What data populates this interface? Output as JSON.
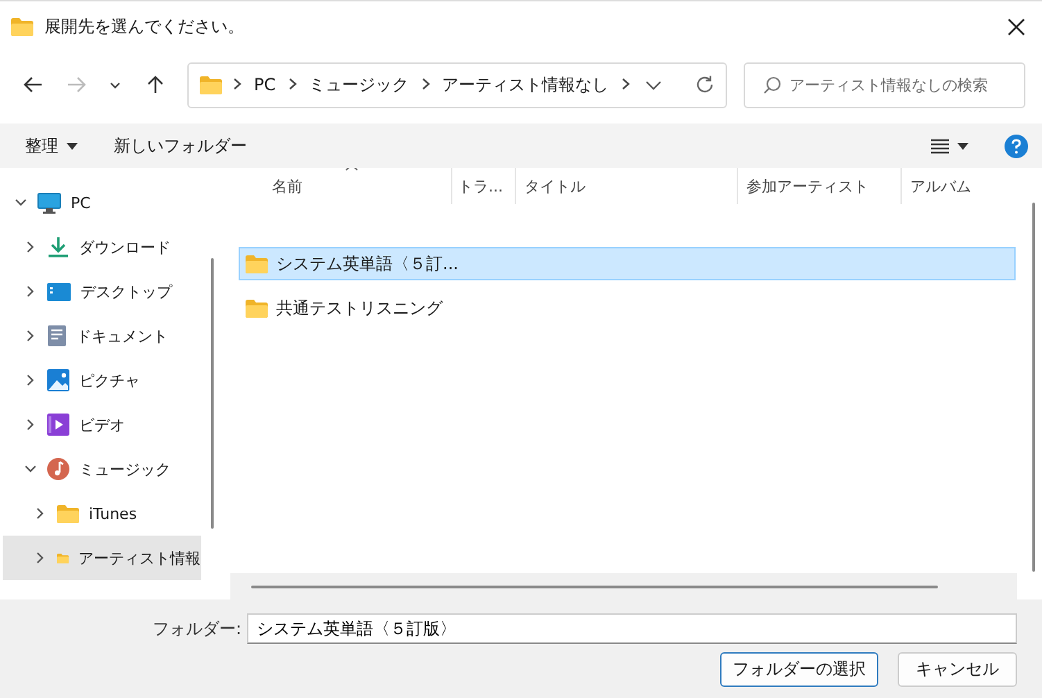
{
  "window": {
    "title": "展開先を選んでください。"
  },
  "navigation": {
    "forward_disabled": true,
    "address": [
      "PC",
      "ミュージック",
      "アーティスト情報なし"
    ],
    "search": {
      "placeholder": "アーティスト情報なしの検索"
    }
  },
  "toolbar": {
    "organize": "整理",
    "new_folder": "新しいフォルダー"
  },
  "tree": {
    "items": [
      {
        "label": "PC",
        "kind": "pc",
        "expanded": true,
        "selected": false,
        "children": [
          {
            "label": "ダウンロード",
            "kind": "download",
            "expanded": false,
            "selected": false
          },
          {
            "label": "デスクトップ",
            "kind": "desktop",
            "expanded": false,
            "selected": false
          },
          {
            "label": "ドキュメント",
            "kind": "document",
            "expanded": false,
            "selected": false
          },
          {
            "label": "ピクチャ",
            "kind": "picture",
            "expanded": false,
            "selected": false
          },
          {
            "label": "ビデオ",
            "kind": "video",
            "expanded": false,
            "selected": false
          },
          {
            "label": "ミュージック",
            "kind": "music",
            "expanded": true,
            "selected": false,
            "children": [
              {
                "label": "iTunes",
                "kind": "folder",
                "expanded": false,
                "selected": false
              },
              {
                "label": "アーティスト情報",
                "kind": "folder",
                "expanded": false,
                "selected": true
              }
            ]
          }
        ]
      }
    ]
  },
  "table": {
    "columns": [
      {
        "label": "名前",
        "sorted": true
      },
      {
        "label": "トラ...",
        "sorted": false
      },
      {
        "label": "タイトル",
        "sorted": false
      },
      {
        "label": "参加アーティスト",
        "sorted": false
      },
      {
        "label": "アルバム",
        "sorted": false
      }
    ],
    "rows": [
      {
        "name": "システム英単語〈５訂...",
        "selected": true
      },
      {
        "name": "共通テストリスニング",
        "selected": false
      }
    ]
  },
  "footer": {
    "folder_label": "フォルダー:",
    "folder_value": "システム英単語〈５訂版〉",
    "buttons": [
      {
        "label": "フォルダーの選択",
        "primary": true
      },
      {
        "label": "キャンセル",
        "primary": false
      }
    ]
  }
}
